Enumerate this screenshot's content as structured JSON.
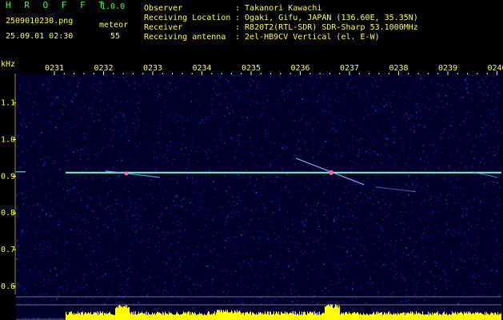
{
  "app": {
    "name": "H R O F F T",
    "version": "1.0.0"
  },
  "file": {
    "name": "2509010230.png",
    "datetime": "25.09.01 02:30",
    "meteor_label": "meteor",
    "meteor_count": "55"
  },
  "info": [
    {
      "label": "Observer",
      "value": ": Takanori Kawachi"
    },
    {
      "label": "Receiving Location",
      "value": ": Ogaki, Gifu, JAPAN (136.60E, 35.35N)"
    },
    {
      "label": "Receiver",
      "value": ": R820T2(RTL-SDR) SDR-Sharp 53.1000MHz"
    },
    {
      "label": "Receiving antenna",
      "value": ": 2el-HB9CV Vertical (el. E-W)"
    }
  ],
  "spectrogram": {
    "unit": "kHz",
    "time_ticks": [
      "0231",
      "0232",
      "0233",
      "0234",
      "0235",
      "0236",
      "0237",
      "0238",
      "0239",
      "0240"
    ],
    "freq_ticks": [
      "1.1",
      "1.0",
      "0.9",
      "0.8",
      "0.7",
      "0.6"
    ],
    "freq_range": [
      0.58,
      1.18
    ],
    "carrier_khz": 0.91,
    "colors": {
      "background": "#00002a",
      "noise": "#1a2a9a",
      "carrier": "#66ffcc",
      "meteor": "#ff66aa",
      "axis_text": "#ffff3c",
      "bars": "#ffff00"
    }
  }
}
